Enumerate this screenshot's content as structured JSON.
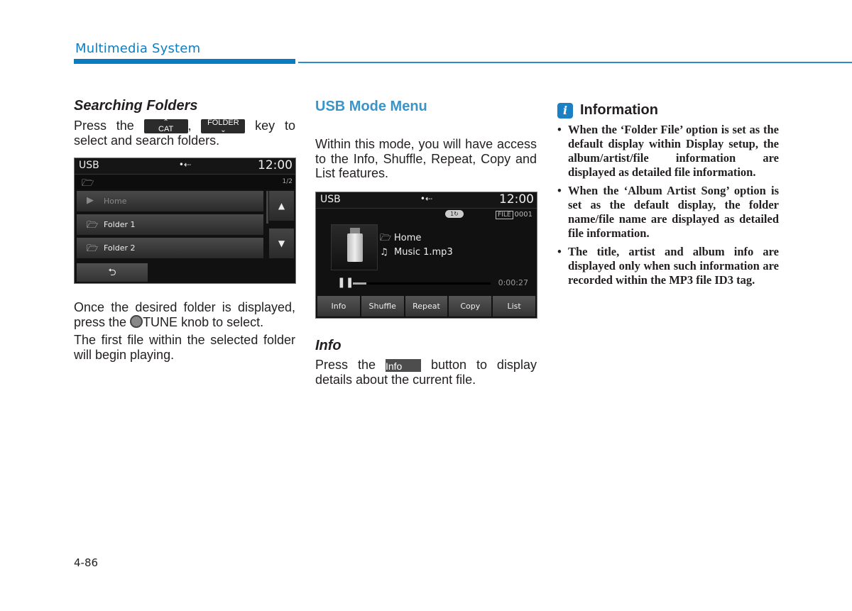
{
  "header": {
    "section_title": "Multimedia System",
    "accent_color": "#0a7bc1"
  },
  "column1": {
    "heading": "Searching Folders",
    "intro_before": "Press the",
    "key_cat": {
      "label": "CAT",
      "arrow": "^"
    },
    "separator": ",",
    "key_folder": {
      "label": "FOLDER",
      "arrow": "v"
    },
    "intro_after": "key to",
    "intro_line2": "select and search folders.",
    "screen": {
      "source": "USB",
      "usb_icon": "usb-icon",
      "clock": "12:00",
      "page_indicator": "1/2",
      "rows": [
        {
          "icon": "play-circle-icon",
          "label": "Home"
        },
        {
          "icon": "folder-icon",
          "label": "Folder 1"
        },
        {
          "icon": "folder-icon",
          "label": "Folder 2"
        }
      ],
      "up_glyph": "▲",
      "down_glyph": "▼",
      "back_glyph": "⮌"
    },
    "para1_before": "Once the desired folder is displayed, press the",
    "para1_after": "TUNE knob to select.",
    "para2": "The first file within the selected folder will begin playing."
  },
  "column2": {
    "heading": "USB Mode Menu",
    "intro": "Within this mode, you will have access to the Info, Shuffle, Repeat, Copy and List features.",
    "screen": {
      "source": "USB",
      "clock": "12:00",
      "file_label": "FILE",
      "file_number": "0001",
      "mode_badge": "1↻",
      "folder": "Home",
      "song": "Music 1.mp3",
      "elapsed": "0:00:27",
      "progress_fraction": 0.1,
      "tabs": [
        "Info",
        "Shuffle",
        "Repeat",
        "Copy",
        "List"
      ]
    },
    "sub_heading": "Info",
    "info_before": "Press the",
    "info_key": "Info",
    "info_after": "button to display details about the current file."
  },
  "column3": {
    "badge": "i",
    "title": "Information",
    "items": [
      "When the ‘Folder File’ option is set as the default display within Display setup, the album/artist/file information are displayed as detailed file information.",
      "When the ‘Album Artist Song’ option is set as the default display, the folder name/file name are displayed as detailed file information.",
      "The title, artist and album info are displayed only when such information are recorded within the MP3 file ID3 tag."
    ]
  },
  "footer": {
    "page_number": "4-86"
  }
}
